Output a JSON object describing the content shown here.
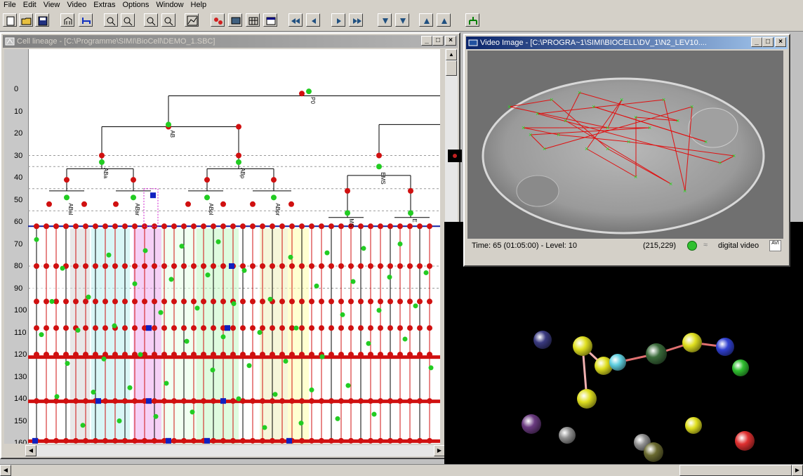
{
  "menu": [
    "File",
    "Edit",
    "View",
    "Video",
    "Extras",
    "Options",
    "Window",
    "Help"
  ],
  "lineage_window": {
    "title": "Cell lineage - [C:\\Programme\\SIMI\\BioCell\\DEMO_1.SBC]",
    "min": "_",
    "max": "□",
    "close": "×",
    "ruler_ticks": [
      "0",
      "10",
      "20",
      "30",
      "40",
      "50",
      "60",
      "70",
      "80",
      "90",
      "100",
      "110",
      "120",
      "130",
      "140",
      "150",
      "160"
    ],
    "cells": [
      "P0",
      "AB",
      "ABa",
      "ABp",
      "EMS",
      "ABal",
      "ABar",
      "ABpl",
      "ABpr",
      "MS",
      "E"
    ]
  },
  "video_window": {
    "title": "Video Image - [C:\\PROGRA~1\\SIMI\\BIOCELL\\DV_1\\N2_LEV10....",
    "min": "_",
    "max": "□",
    "close": "×",
    "status_time": "Time: 65 (01:05:00)  -  Level: 10",
    "status_coords": "(215,229)",
    "status_source": "digital video",
    "status_format": "AVI"
  },
  "colors": {
    "node_red": "#d01010",
    "node_green": "#22cc22",
    "mark_blue": "#1020c0"
  }
}
